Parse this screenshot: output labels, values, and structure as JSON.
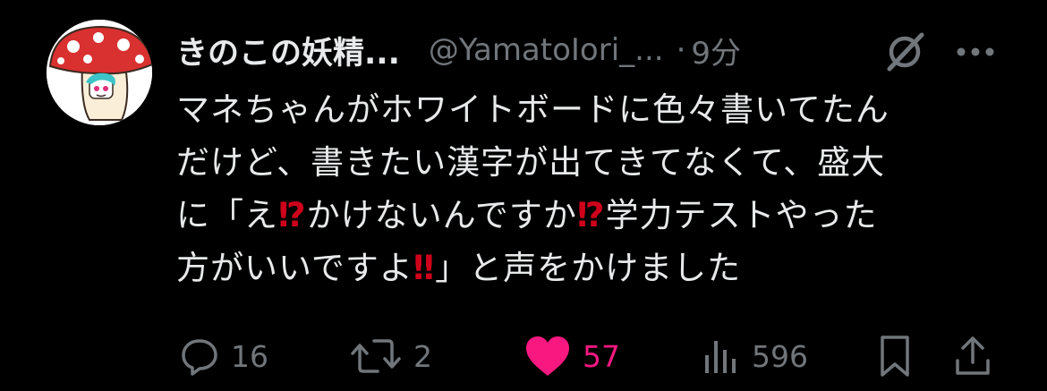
{
  "tweet": {
    "display_name": "きのこの妖精...",
    "handle": "@YamatoIori_...",
    "separator": "·",
    "time": "9分",
    "body_lines": [
      [
        "マネちゃんがホワイトボードに色々書いてたん"
      ],
      [
        "だけど、書きたい漢字が出てきてなくて、盛大"
      ],
      [
        "に「え",
        "⁉",
        "かけないんですか",
        "⁉",
        "学力テストやった"
      ],
      [
        "方がいいですよ",
        "‼",
        "」と声をかけました"
      ]
    ]
  },
  "actions": {
    "reply_count": "16",
    "repost_count": "2",
    "like_count": "57",
    "views_count": "596"
  },
  "colors": {
    "background": "#000000",
    "text_primary": "#e7e9ea",
    "text_secondary": "#71767b",
    "like_pink": "#f91880",
    "emoji_red": "#d0021b"
  },
  "icons": {
    "grok": "grok-icon",
    "more": "more-icon",
    "reply": "reply-icon",
    "repost": "repost-icon",
    "like": "heart-icon",
    "views": "views-icon",
    "bookmark": "bookmark-icon",
    "share": "share-icon"
  }
}
